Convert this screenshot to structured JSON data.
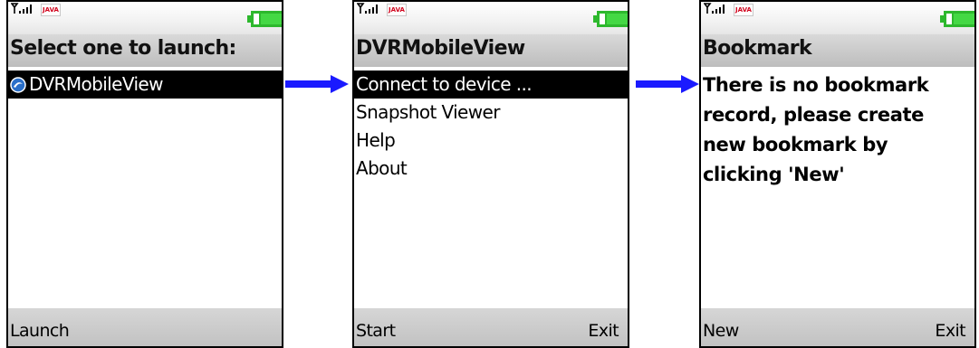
{
  "colors": {
    "arrow": "#1a1aff",
    "selection_bg": "#000000",
    "softbar": "#c8c8c8",
    "battery": "#2db82d",
    "java_badge": "#d0021b"
  },
  "status": {
    "java_badge": "JAVA",
    "signal_icon": "signal-icon",
    "battery_icon": "battery-icon"
  },
  "screens": [
    {
      "title": "Select one to launch:",
      "items": [
        {
          "label": "DVRMobileView",
          "icon": "app-icon",
          "selected": true
        }
      ],
      "softkeys": {
        "left": "Launch",
        "right": ""
      }
    },
    {
      "title": "DVRMobileView",
      "items": [
        {
          "label": "Connect to device ...",
          "selected": true
        },
        {
          "label": "Snapshot Viewer"
        },
        {
          "label": "Help"
        },
        {
          "label": "About"
        }
      ],
      "softkeys": {
        "left": "Start",
        "right": "Exit"
      }
    },
    {
      "title": "Bookmark",
      "message": "There is no bookmark record, please create new bookmark by clicking 'New'",
      "softkeys": {
        "left": "New",
        "right": "Exit"
      }
    }
  ],
  "arrows": [
    {
      "icon": "right-arrow-icon"
    },
    {
      "icon": "right-arrow-icon"
    }
  ]
}
